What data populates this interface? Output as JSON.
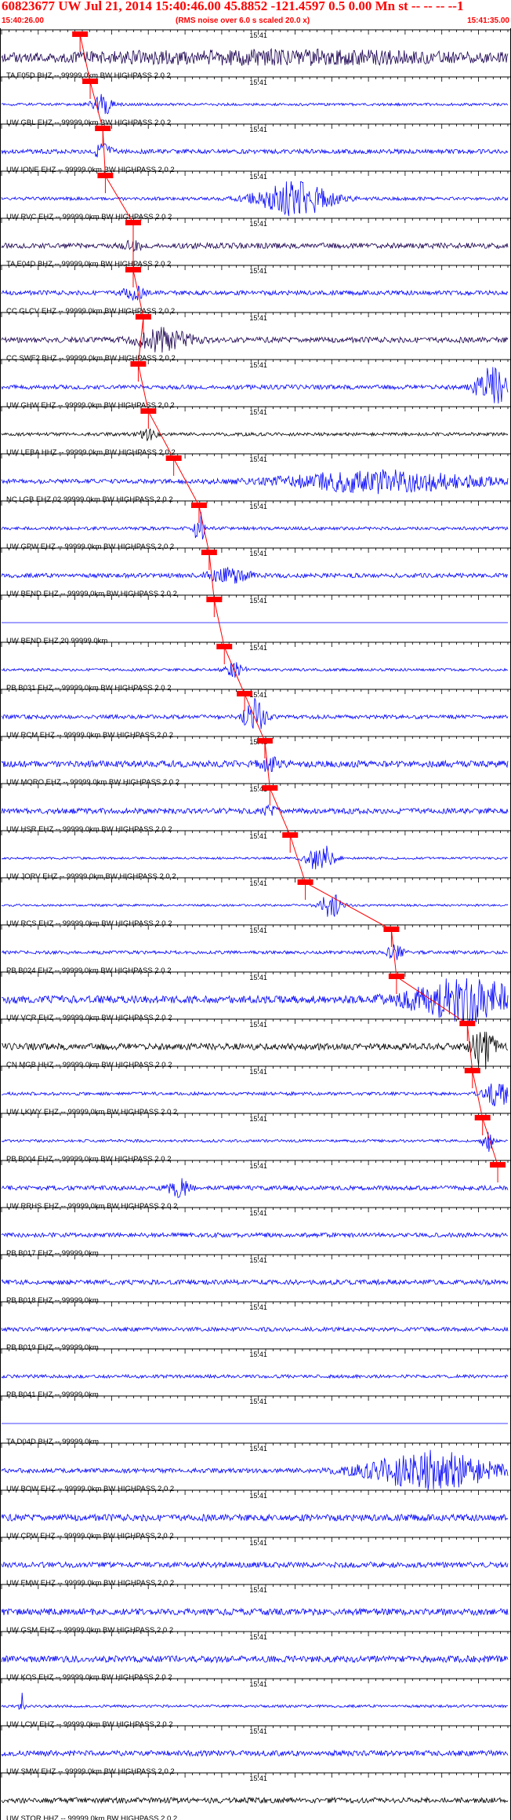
{
  "chart_data": {
    "type": "line",
    "title": "60823677 UW Jul 21, 2014 15:40:46.00   45.8852 -121.4597  0.5 0.00 Mn st -- -- -- --1",
    "subtitle": "(RMS noise over 6.0 s scaled 20.0 x)",
    "time_start": "15:40:26.00",
    "time_end": "15:41:35.00",
    "minute_mark": "15:41",
    "x_range": [
      "15:40:26.00",
      "15:41:35.00"
    ],
    "colors": {
      "header": "#ff0000",
      "pick": "#ff0000",
      "trace_blue": "#0000ff",
      "trace_dark": "#1a0050",
      "trace_black": "#000000",
      "axis": "#000000"
    },
    "series": [
      {
        "label": "TA F05D BHZ -- 99999.0km BW  HIGHPASS  2.0  2",
        "color": "#1a0050",
        "noise": 0.3,
        "pick": 0.155,
        "burst_center": 0.55,
        "burst_amp": 0.5,
        "burst_width": 0.45,
        "seed": 1
      },
      {
        "label": "UW GBL EHZ -- 99999.0km BW  HIGHPASS  2.0  2",
        "color": "#0000ff",
        "noise": 0.12,
        "pick": 0.175,
        "burst_center": 0.2,
        "burst_amp": 0.9,
        "burst_width": 0.02,
        "seed": 2
      },
      {
        "label": "UW IONE EHZ -- 99999.0km BW  HIGHPASS  2.0  2",
        "color": "#0000ff",
        "noise": 0.2,
        "pick": 0.2,
        "burst_center": 0.2,
        "burst_amp": 0.7,
        "burst_width": 0.015,
        "seed": 3
      },
      {
        "label": "UW RVC EHZ -- 99999.0km BW  HIGHPASS  2.0  2",
        "color": "#0000ff",
        "noise": 0.15,
        "pick": 0.205,
        "burst_center": 0.58,
        "burst_amp": 1.6,
        "burst_width": 0.07,
        "seed": 4
      },
      {
        "label": "TA E04D BHZ -- 99999.0km BW  HIGHPASS  2.0  2",
        "color": "#1a0050",
        "noise": 0.25,
        "pick": 0.26,
        "burst_center": 0.26,
        "burst_amp": 0.3,
        "burst_width": 0.02,
        "seed": 5
      },
      {
        "label": "CC GLCV EHZ -- 99999.0km BW  HIGHPASS  2.0  2",
        "color": "#0000ff",
        "noise": 0.2,
        "pick": 0.26,
        "burst_center": 0.26,
        "burst_amp": 0.6,
        "burst_width": 0.02,
        "seed": 6
      },
      {
        "label": "CC SWF2 BHZ -- 99999.0km BW  HIGHPASS  2.0  2",
        "color": "#1a0050",
        "noise": 0.25,
        "pick": 0.28,
        "burst_center": 0.32,
        "burst_amp": 1.0,
        "burst_width": 0.05,
        "seed": 7
      },
      {
        "label": "UW GHW EHZ -- 99999.0km BW  HIGHPASS  2.0  2",
        "color": "#0000ff",
        "noise": 0.2,
        "pick": 0.27,
        "burst_center": 0.97,
        "burst_amp": 1.8,
        "burst_width": 0.03,
        "seed": 8
      },
      {
        "label": "UW LEBA HHZ -- 99999.0km BW  HIGHPASS  2.0  2",
        "color": "#000000",
        "noise": 0.15,
        "pick": 0.29,
        "burst_center": 0.29,
        "burst_amp": 0.5,
        "burst_width": 0.015,
        "seed": 9
      },
      {
        "label": "NC LGB EHZ 02 99999.0km BW  HIGHPASS  2.0  2",
        "color": "#0000ff",
        "noise": 0.2,
        "pick": 0.34,
        "burst_center": 0.75,
        "burst_amp": 1.0,
        "burst_width": 0.18,
        "seed": 10
      },
      {
        "label": "UW GPW EHZ -- 99999.0km BW  HIGHPASS  2.0  2",
        "color": "#0000ff",
        "noise": 0.15,
        "pick": 0.39,
        "burst_center": 0.39,
        "burst_amp": 1.8,
        "burst_width": 0.008,
        "seed": 11
      },
      {
        "label": "UW BEND EHZ -- 99999.0km BW  HIGHPASS  2.0  2",
        "color": "#0000ff",
        "noise": 0.2,
        "pick": 0.41,
        "burst_center": 0.45,
        "burst_amp": 0.6,
        "burst_width": 0.04,
        "seed": 12
      },
      {
        "label": "UW BEND EHZ 20 99999.0km",
        "color": "#0000ff",
        "noise": 0.0,
        "pick": 0.42,
        "burst_center": 0.5,
        "burst_amp": 0.0,
        "burst_width": 0.01,
        "seed": 13
      },
      {
        "label": "PB B031 EHZ -- 99999.0km BW  HIGHPASS  2.0  2",
        "color": "#0000ff",
        "noise": 0.12,
        "pick": 0.44,
        "burst_center": 0.46,
        "burst_amp": 0.6,
        "burst_width": 0.02,
        "seed": 14
      },
      {
        "label": "UW RCM EHZ -- 99999.0km BW  HIGHPASS  2.0  2",
        "color": "#0000ff",
        "noise": 0.18,
        "pick": 0.48,
        "burst_center": 0.5,
        "burst_amp": 1.6,
        "burst_width": 0.02,
        "seed": 15
      },
      {
        "label": "UW MORO EHZ -- 99999.0km BW  HIGHPASS  2.0  2",
        "color": "#0000ff",
        "noise": 0.3,
        "pick": 0.52,
        "burst_center": 0.53,
        "burst_amp": 0.6,
        "burst_width": 0.02,
        "seed": 16
      },
      {
        "label": "UW HSR EHZ -- 99999.0km BW  HIGHPASS  2.0  2",
        "color": "#0000ff",
        "noise": 0.25,
        "pick": 0.53,
        "burst_center": 0.53,
        "burst_amp": 0.3,
        "burst_width": 0.015,
        "seed": 17
      },
      {
        "label": "UW JORV EHZ -- 99999.0km BW  HIGHPASS  2.0  2",
        "color": "#0000ff",
        "noise": 0.1,
        "pick": 0.57,
        "burst_center": 0.63,
        "burst_amp": 1.4,
        "burst_width": 0.025,
        "seed": 18
      },
      {
        "label": "UW RCS EHZ -- 99999.0km BW  HIGHPASS  2.0  2",
        "color": "#0000ff",
        "noise": 0.1,
        "pick": 0.6,
        "burst_center": 0.65,
        "burst_amp": 1.2,
        "burst_width": 0.02,
        "seed": 19
      },
      {
        "label": "PB B024 EHZ -- 99999.0km BW  HIGHPASS  2.0  2",
        "color": "#0000ff",
        "noise": 0.15,
        "pick": 0.77,
        "burst_center": 0.78,
        "burst_amp": 0.9,
        "burst_width": 0.015,
        "seed": 20
      },
      {
        "label": "UW VCR EHZ -- 99999.0km BW  HIGHPASS  2.0  2",
        "color": "#0000ff",
        "noise": 0.35,
        "pick": 0.78,
        "burst_center": 0.91,
        "burst_amp": 2.0,
        "burst_width": 0.1,
        "seed": 21
      },
      {
        "label": "CN MGB HHZ -- 99999.0km BW  HIGHPASS  2.0  2",
        "color": "#000000",
        "noise": 0.3,
        "pick": 0.92,
        "burst_center": 0.95,
        "burst_amp": 2.0,
        "burst_width": 0.02,
        "seed": 22
      },
      {
        "label": "UW LKWY EHZ -- 99999.0km BW  HIGHPASS  2.0  2",
        "color": "#0000ff",
        "noise": 0.15,
        "pick": 0.93,
        "burst_center": 0.98,
        "burst_amp": 1.2,
        "burst_width": 0.025,
        "seed": 23
      },
      {
        "label": "PB B004 EHZ -- 99999.0km BW  HIGHPASS  2.0  2",
        "color": "#0000ff",
        "noise": 0.12,
        "pick": 0.95,
        "burst_center": 0.96,
        "burst_amp": 1.0,
        "burst_width": 0.01,
        "seed": 24
      },
      {
        "label": "UW RRHS EHZ -- 99999.0km BW  HIGHPASS  2.0  2",
        "color": "#0000ff",
        "noise": 0.2,
        "pick": 0.98,
        "burst_center": 0.35,
        "burst_amp": 0.8,
        "burst_width": 0.02,
        "seed": 25
      },
      {
        "label": "PB B017 EHZ -- 99999.0km",
        "color": "#0000ff",
        "noise": 0.2,
        "pick": null,
        "burst_center": 0.5,
        "burst_amp": 0.0,
        "burst_width": 0.01,
        "seed": 26
      },
      {
        "label": "PB B018 EHZ -- 99999.0km",
        "color": "#0000ff",
        "noise": 0.22,
        "pick": null,
        "burst_center": 0.5,
        "burst_amp": 0.0,
        "burst_width": 0.01,
        "seed": 27
      },
      {
        "label": "PB B019 EHZ -- 99999.0km",
        "color": "#0000ff",
        "noise": 0.18,
        "pick": null,
        "burst_center": 0.5,
        "burst_amp": 0.0,
        "burst_width": 0.01,
        "seed": 28
      },
      {
        "label": "PB B041 EHZ -- 99999.0km",
        "color": "#0000ff",
        "noise": 0.15,
        "pick": null,
        "burst_center": 0.5,
        "burst_amp": 0.0,
        "burst_width": 0.01,
        "seed": 29
      },
      {
        "label": "TA D04D BHZ -- 99999.0km",
        "color": "#0000ff",
        "noise": 0.0,
        "pick": null,
        "burst_center": 0.5,
        "burst_amp": 0.0,
        "burst_width": 0.01,
        "seed": 30
      },
      {
        "label": "UW BOW EHZ -- 99999.0km BW  HIGHPASS  2.0  2",
        "color": "#0000ff",
        "noise": 0.2,
        "pick": null,
        "burst_center": 0.85,
        "burst_amp": 1.7,
        "burst_width": 0.12,
        "seed": 31
      },
      {
        "label": "UW CPW EHZ -- 99999.0km BW  HIGHPASS  2.0  2",
        "color": "#0000ff",
        "noise": 0.3,
        "pick": null,
        "burst_center": 0.5,
        "burst_amp": 0.0,
        "burst_width": 0.01,
        "seed": 32
      },
      {
        "label": "UW FMW EHZ -- 99999.0km BW  HIGHPASS  2.0  2",
        "color": "#0000ff",
        "noise": 0.25,
        "pick": null,
        "burst_center": 0.5,
        "burst_amp": 0.0,
        "burst_width": 0.01,
        "seed": 33
      },
      {
        "label": "UW GSM EHZ -- 99999.0km BW  HIGHPASS  2.0  2",
        "color": "#0000ff",
        "noise": 0.3,
        "pick": null,
        "burst_center": 0.5,
        "burst_amp": 0.0,
        "burst_width": 0.01,
        "seed": 34
      },
      {
        "label": "UW KOS EHZ -- 99999.0km BW  HIGHPASS  2.0  2",
        "color": "#0000ff",
        "noise": 0.3,
        "pick": null,
        "burst_center": 0.5,
        "burst_amp": 0.0,
        "burst_width": 0.01,
        "seed": 35
      },
      {
        "label": "UW LCW EHZ -- 99999.0km BW  HIGHPASS  2.0  2",
        "color": "#0000ff",
        "noise": 0.12,
        "pick": null,
        "burst_center": 0.04,
        "burst_amp": 1.3,
        "burst_width": 0.004,
        "seed": 36
      },
      {
        "label": "UW SMW EHZ -- 99999.0km BW  HIGHPASS  2.0  2",
        "color": "#0000ff",
        "noise": 0.25,
        "pick": null,
        "burst_center": 0.5,
        "burst_amp": 0.0,
        "burst_width": 0.01,
        "seed": 37
      },
      {
        "label": "UW STOR HHZ -- 99999.0km BW  HIGHPASS  2.0  2",
        "color": "#000000",
        "noise": 0.25,
        "pick": null,
        "burst_center": 0.5,
        "burst_amp": 0.0,
        "burst_width": 0.01,
        "seed": 38
      }
    ]
  }
}
